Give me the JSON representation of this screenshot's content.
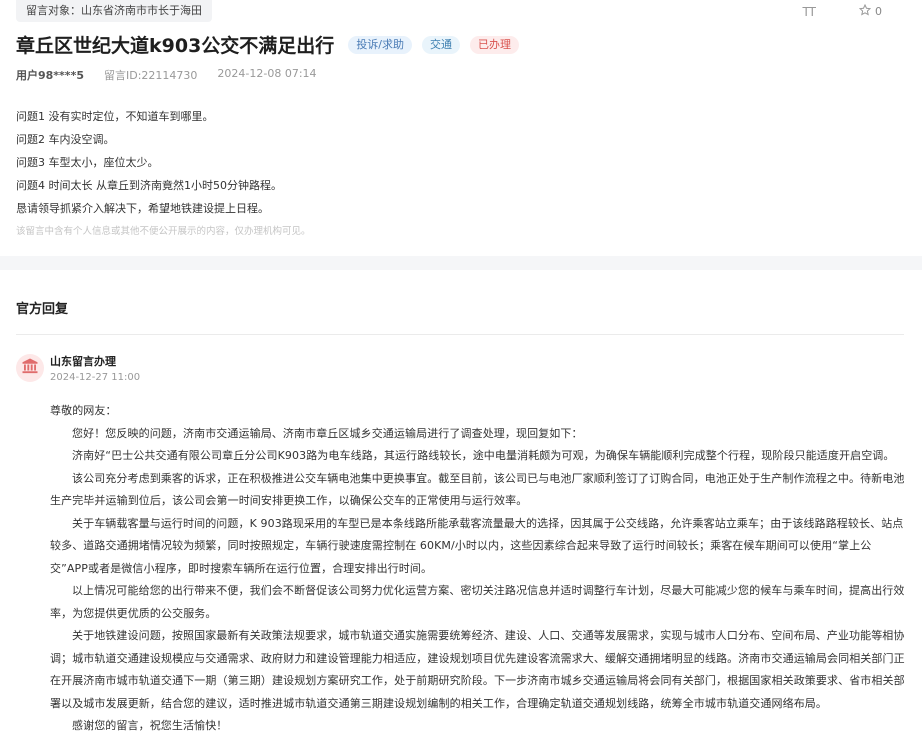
{
  "header": {
    "target_label": "留言对象：山东省济南市市长于海田",
    "font_tool": "TT",
    "star_count": "0"
  },
  "message": {
    "title": "章丘区世纪大道k903公交不满足出行",
    "badges": [
      "投诉/求助",
      "交通",
      "已办理"
    ],
    "user": "用户98****5",
    "id_label": "留言ID:22114730",
    "datetime": "2024-12-08 07:14",
    "lines": [
      "问题1 没有实时定位，不知道车到哪里。",
      "问题2 车内没空调。",
      "问题3 车型太小，座位太少。",
      "问题4 时间太长 从章丘到济南竟然1小时50分钟路程。",
      "恳请领导抓紧介入解决下，希望地铁建设提上日程。"
    ],
    "privacy_notice": "该留言中含有个人信息或其他不便公开展示的内容，仅办理机构可见。"
  },
  "reply": {
    "section_title": "官方回复",
    "org_name": "山东留言办理",
    "datetime": "2024-12-27 11:00",
    "paragraphs": [
      "尊敬的网友：",
      "您好！您反映的问题，济南市交通运输局、济南市章丘区城乡交通运输局进行了调查处理，现回复如下：",
      "济南好“巴士公共交通有限公司章丘分公司K903路为电车线路，其运行路线较长，途中电量消耗颇为可观，为确保车辆能顺利完成整个行程，现阶段只能适度开启空调。",
      "该公司充分考虑到乘客的诉求，正在积极推进公交车辆电池集中更换事宜。截至目前，该公司已与电池厂家顺利签订了订购合同，电池正处于生产制作流程之中。待新电池生产完毕并运输到位后，该公司会第一时间安排更换工作，以确保公交车的正常使用与运行效率。",
      "关于车辆载客量与运行时间的问题，K 903路现采用的车型已是本条线路所能承载客流量最大的选择，因其属于公交线路，允许乘客站立乘车；由于该线路路程较长、站点较多、道路交通拥堵情况较为频繁，同时按照规定，车辆行驶速度需控制在 60KM/小时以内，这些因素综合起来导致了运行时间较长；乘客在候车期间可以使用“掌上公交”APP或者是微信小程序，即时搜索车辆所在运行位置，合理安排出行时间。",
      "以上情况可能给您的出行带来不便，我们会不断督促该公司努力优化运营方案、密切关注路况信息并适时调整行车计划，尽最大可能减少您的候车与乘车时间，提高出行效率，为您提供更优质的公交服务。",
      "关于地铁建设问题，按照国家最新有关政策法规要求，城市轨道交通实施需要统筹经济、建设、人口、交通等发展需求，实现与城市人口分布、空间布局、产业功能等相协调；城市轨道交通建设规模应与交通需求、政府财力和建设管理能力相适应，建设规划项目优先建设客流需求大、缓解交通拥堵明显的线路。济南市交通运输局会同相关部门正在开展济南市城市轨道交通下一期（第三期）建设规划方案研究工作，处于前期研究阶段。下一步济南市城乡交通运输局将会同有关部门，根据国家相关政策要求、省市相关部署以及城市发展更新，结合您的建议，适时推进城市轨道交通第三期建设规划编制的相关工作，合理确定轨道交通规划线路，统筹全市城市轨道交通网络布局。",
      "感谢您的留言，祝您生活愉快！"
    ]
  }
}
